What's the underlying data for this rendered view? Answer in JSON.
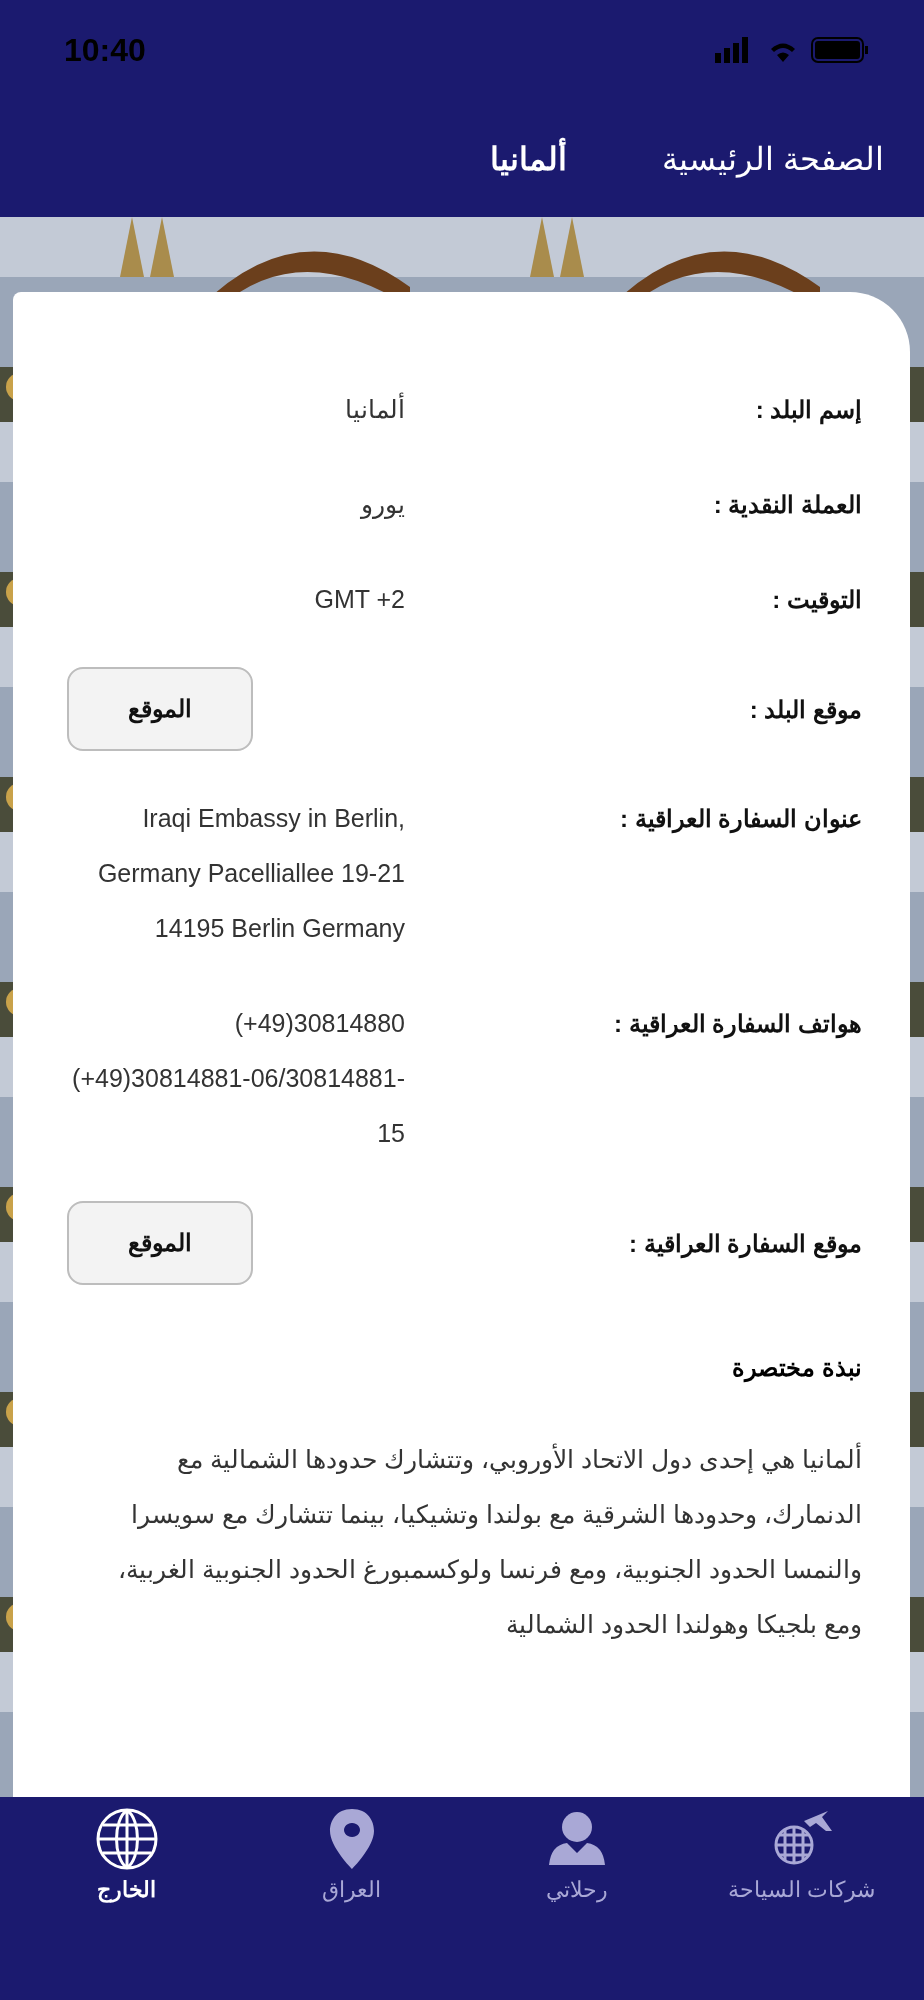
{
  "status_bar": {
    "time": "10:40"
  },
  "nav": {
    "back": "الصفحة الرئيسية",
    "title": "ألمانيا"
  },
  "rows": [
    {
      "kind": "text",
      "label": "إسم البلد :",
      "value": "ألمانيا"
    },
    {
      "kind": "text",
      "label": "العملة النقدية :",
      "value": "يورو"
    },
    {
      "kind": "text",
      "label": "التوقيت :",
      "value": "GMT +2"
    },
    {
      "kind": "button",
      "label": "موقع البلد  :",
      "value": "الموقع"
    },
    {
      "kind": "text",
      "label": "عنوان السفارة العراقية :",
      "value": "Iraqi Embassy in Berlin, Germany Pacelliallee 19-21 14195 Berlin Germany"
    },
    {
      "kind": "text",
      "label": "هواتف السفارة العراقية :",
      "value": "(+49)30814880 (+49)30814881-06/30814881-15"
    },
    {
      "kind": "button",
      "label": "موقع السفارة العراقية  :",
      "value": "الموقع"
    }
  ],
  "about": {
    "heading": "نبذة مختصرة",
    "text": "ألمانيا هي إحدى دول الاتحاد الأوروبي، وتتشارك حدودها الشمالية مع الدنمارك، وحدودها الشرقية مع بولندا وتشيكيا، بينما تتشارك مع سويسرا والنمسا الحدود الجنوبية، ومع فرنسا ولوكسمبورغ الحدود الجنوبية الغربية، ومع بلجيكا وهولندا الحدود الشمالية"
  },
  "tabs": [
    {
      "label": "شركات السياحة",
      "selected": false
    },
    {
      "label": "رحلاتي",
      "selected": false
    },
    {
      "label": "العراق",
      "selected": false
    },
    {
      "label": "الخارج",
      "selected": true
    }
  ]
}
